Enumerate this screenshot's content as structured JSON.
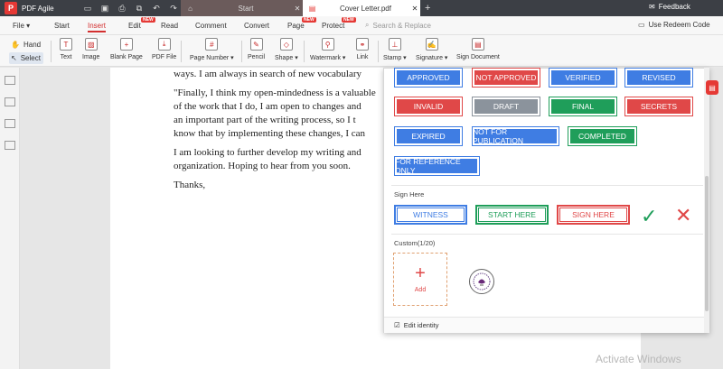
{
  "app": {
    "name": "PDF Agile",
    "logo_letter": "P",
    "feedback": "Feedback"
  },
  "tabs": [
    {
      "label": "Start"
    },
    {
      "label": "Cover Letter.pdf"
    }
  ],
  "menu": {
    "items": [
      "File",
      "Start",
      "Insert",
      "Edit",
      "Read",
      "Comment",
      "Convert",
      "Page",
      "Protect"
    ],
    "new_badge": "NEW",
    "search_placeholder": "Search & Replace",
    "redeem": "Use Redeem Code"
  },
  "ribbon": {
    "hand": "Hand",
    "select": "Select",
    "tools": [
      "Text",
      "Image",
      "Blank Page",
      "PDF File",
      "Page Number",
      "Pencil",
      "Shape",
      "Watermark",
      "Link",
      "Stamp",
      "Signature",
      "Sign Document"
    ]
  },
  "document": {
    "paragraphs": [
      "ways. I am always in search of new vocabulary",
      "\"Finally, I think my open-mindedness is a valuable",
      "of the work that I do, I am open to changes and",
      "an important part of the writing process, so I t",
      "know that by implementing these changes, I can",
      "I am looking to further develop my writing and",
      "organization. Hoping to hear from you soon.",
      "Thanks,"
    ]
  },
  "stamps": {
    "standard": [
      {
        "label": "APPROVED",
        "style": "blue"
      },
      {
        "label": "NOT APPROVED",
        "style": "red"
      },
      {
        "label": "VERIFIED",
        "style": "blue"
      },
      {
        "label": "REVISED",
        "style": "blue"
      },
      {
        "label": "INVALID",
        "style": "red"
      },
      {
        "label": "DRAFT",
        "style": "gray"
      },
      {
        "label": "FINAL",
        "style": "green"
      },
      {
        "label": "SECRETS",
        "style": "red"
      },
      {
        "label": "EXPIRED",
        "style": "blue"
      },
      {
        "label": "NOT FOR PUBLICATION",
        "style": "blue"
      },
      {
        "label": "COMPLETED",
        "style": "green"
      },
      {
        "label": "FOR REFERENCE ONLY",
        "style": "blue"
      }
    ],
    "sign_here_label": "Sign Here",
    "sign_here": [
      {
        "label": "WITNESS",
        "style": "blue"
      },
      {
        "label": "START HERE",
        "style": "green"
      },
      {
        "label": "SIGN HERE",
        "style": "red"
      }
    ],
    "custom_label": "Custom(1/20)",
    "add_label": "Add",
    "edit_identity": "Edit identity"
  },
  "system": {
    "watermark": "Activate Windows"
  },
  "colors": {
    "accent": "#e53935",
    "blue": "#3f7de3",
    "green": "#1f9e5a",
    "red": "#e04848",
    "gray": "#8b939c"
  }
}
